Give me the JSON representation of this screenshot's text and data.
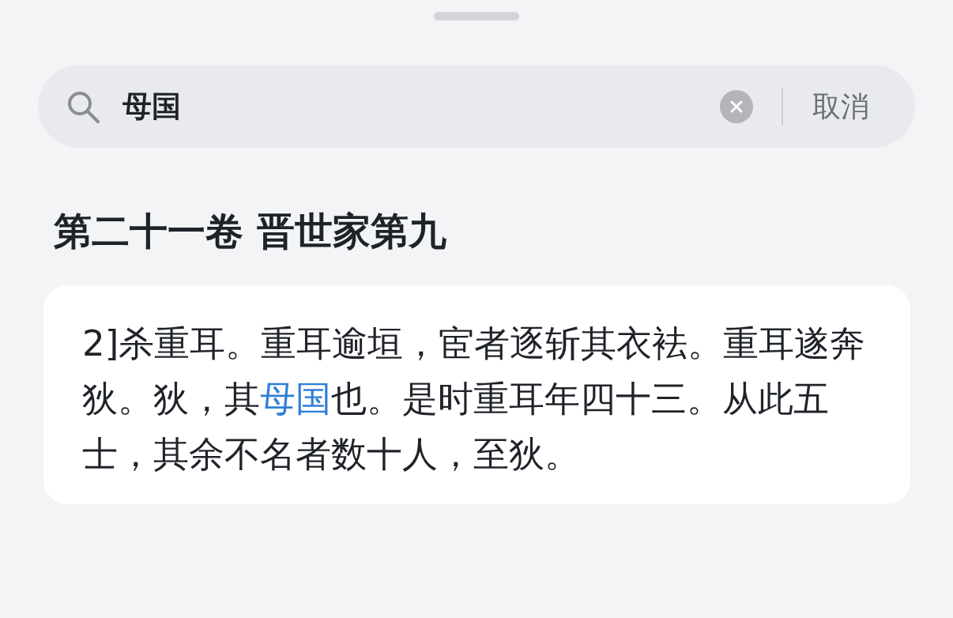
{
  "search": {
    "value": "母国",
    "cancel_label": "取消"
  },
  "section": {
    "title": "第二十一卷 晋世家第九"
  },
  "results": [
    {
      "segments": [
        {
          "text": "2]杀重耳。重耳逾垣，宦者逐斩其衣袪。重耳遂奔狄。狄，其",
          "match": false
        },
        {
          "text": "母国",
          "match": true
        },
        {
          "text": "也。是时重耳年四十三。从此五士，其余不名者数十人，至狄。",
          "match": false
        }
      ]
    }
  ]
}
